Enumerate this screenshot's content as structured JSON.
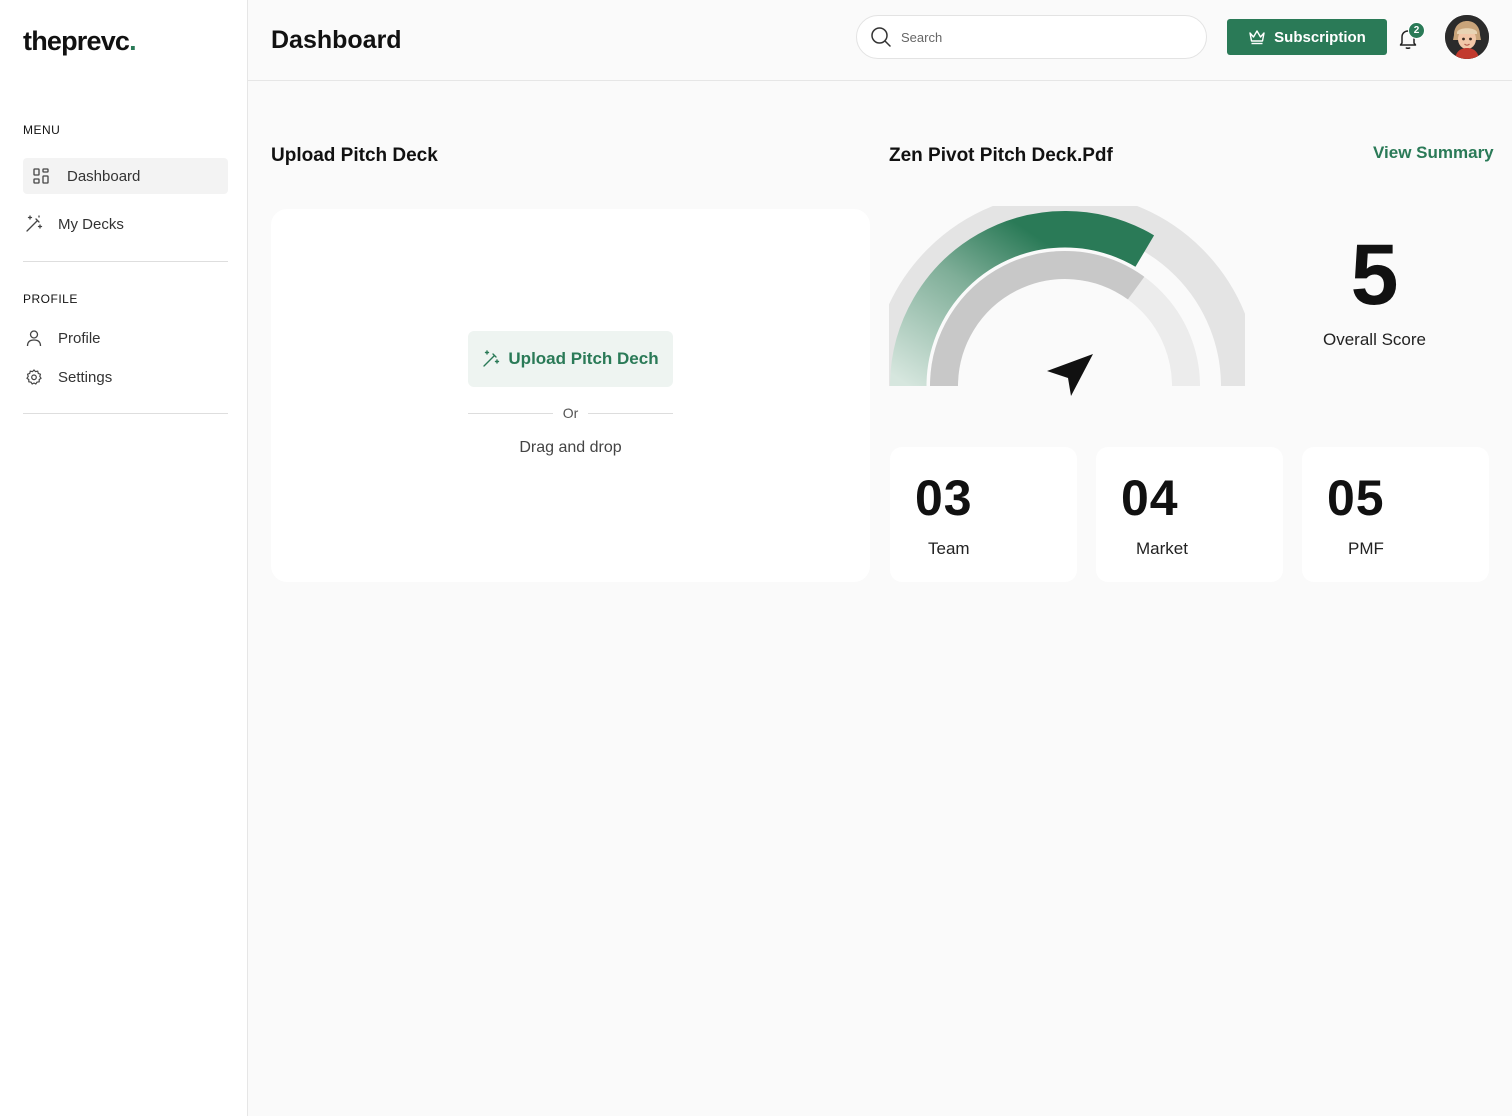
{
  "brand": {
    "name": "theprevc",
    "dot": ".",
    "accent": "#2a7a57"
  },
  "sidebar": {
    "menu_label": "MENU",
    "menu_items": [
      {
        "label": "Dashboard",
        "icon": "grid-icon",
        "active": true
      },
      {
        "label": "My Decks",
        "icon": "magic-wand-icon",
        "active": false
      }
    ],
    "profile_label": "PROFILE",
    "profile_items": [
      {
        "label": "Profile",
        "icon": "user-icon"
      },
      {
        "label": "Settings",
        "icon": "gear-icon"
      }
    ]
  },
  "header": {
    "title": "Dashboard",
    "search_placeholder": "Search",
    "subscription_label": "Subscription",
    "notification_count": "2"
  },
  "upload": {
    "title": "Upload Pitch Deck",
    "button_label": "Upload Pitch Dech",
    "or_text": "Or",
    "drag_text": "Drag and drop"
  },
  "report": {
    "file_title": "Zen Pivot Pitch Deck.Pdf",
    "view_summary_label": "View Summary",
    "overall_score": "5",
    "overall_label": "Overall Score",
    "gauge_fraction": 0.5,
    "metrics": [
      {
        "value": "03",
        "label": "Team"
      },
      {
        "value": "04",
        "label": "Market"
      },
      {
        "value": "05",
        "label": "PMF"
      }
    ]
  }
}
